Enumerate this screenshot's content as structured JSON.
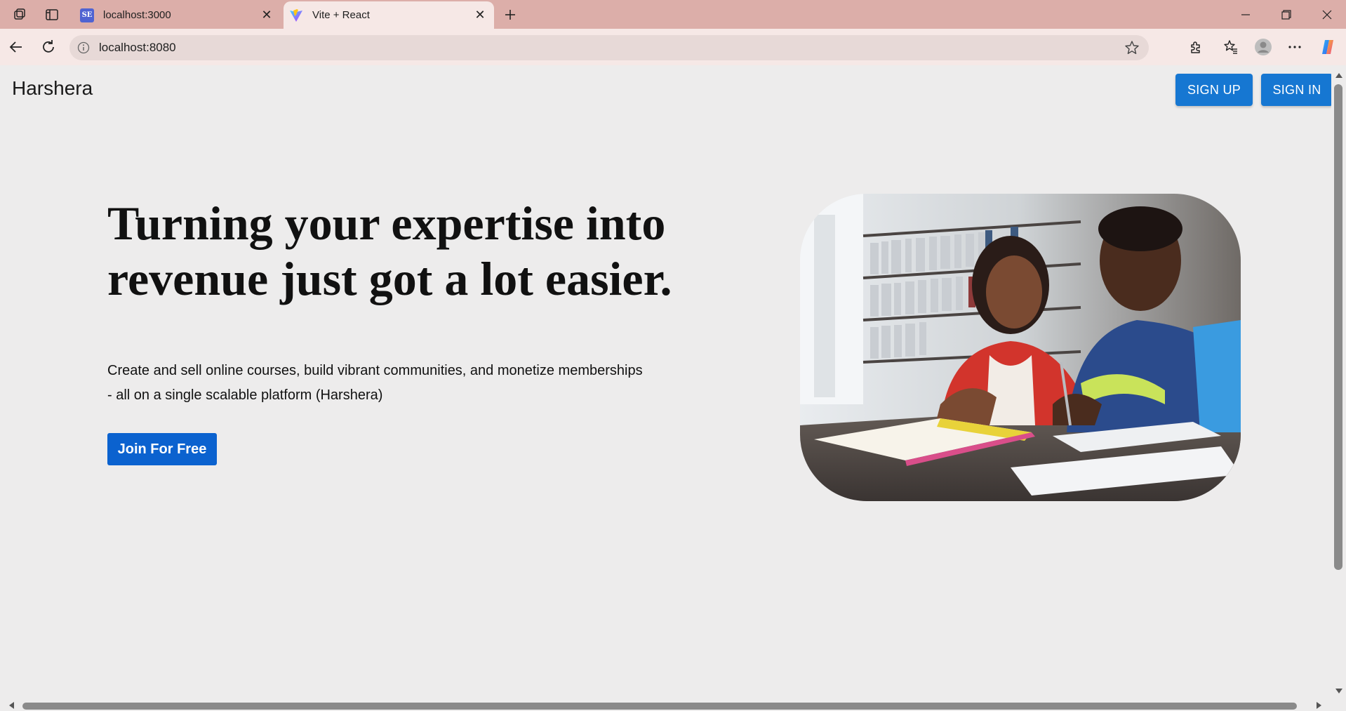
{
  "browser": {
    "tabs": [
      {
        "title": "localhost:3000",
        "favicon": "SE",
        "active": false
      },
      {
        "title": "Vite + React",
        "favicon": "vite-icon",
        "active": true
      }
    ],
    "new_tab_glyph": "+",
    "close_glyph": "✕",
    "url": "localhost:8080",
    "colors": {
      "tabstrip": "#dcaea9",
      "toolbar": "#f6e8e6",
      "omnibox": "#e7d9d7"
    }
  },
  "page": {
    "brand": "Harshera",
    "nav": {
      "signup_label": "SIGN UP",
      "signin_label": "SIGN IN"
    },
    "hero": {
      "headline_line1": "Turning your expertise into",
      "headline_line2": "revenue just got a lot easier.",
      "subtext_line1": "Create and sell online courses, build vibrant communities, and monetize memberships",
      "subtext_line2": "- all on a single scalable platform (Harshera)",
      "cta_label": "Join For Free",
      "image": "students-studying-library-photo"
    },
    "colors": {
      "primary": "#1677d2",
      "cta": "#0b62cf",
      "background": "#edecec"
    }
  }
}
